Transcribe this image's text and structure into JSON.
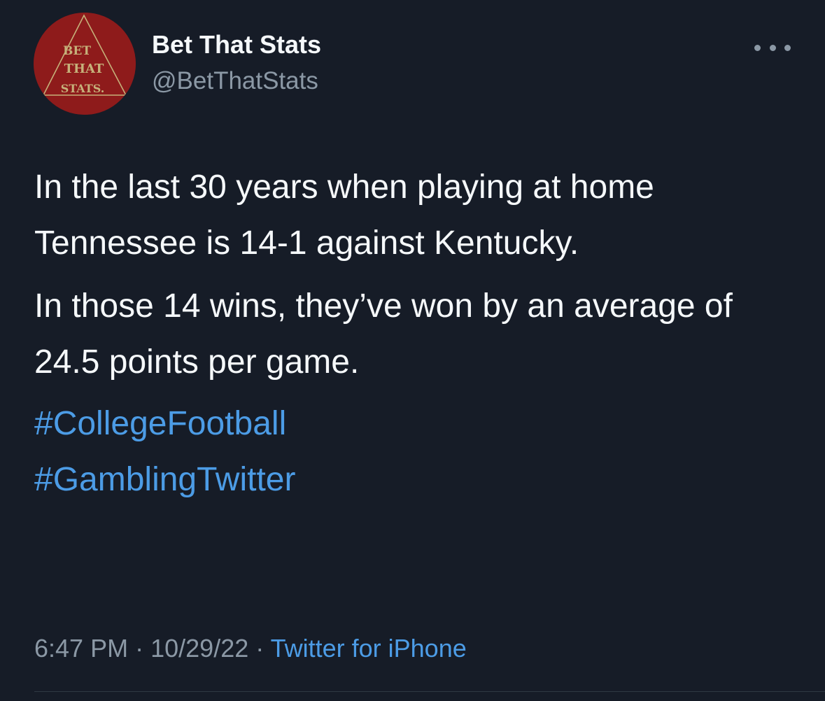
{
  "author": {
    "display_name": "Bet That Stats",
    "handle": "@BetThatStats",
    "avatar_logo_text": [
      "BET",
      "THAT",
      "STATS."
    ]
  },
  "tweet": {
    "paragraph_1": "In the last 30 years when playing at home Tennessee is 14-1 against Kentucky.",
    "paragraph_2": "In those 14 wins, they’ve won by an average of 24.5 points per game.",
    "hashtags": [
      "#CollegeFootball",
      "#GamblingTwitter"
    ]
  },
  "meta": {
    "time": "6:47 PM",
    "separator": "·",
    "date": "10/29/22",
    "source": "Twitter for iPhone"
  },
  "icons": {
    "more": "more-horizontal-icon"
  },
  "colors": {
    "background": "#161c27",
    "text": "#f5f8fa",
    "secondary_text": "#8b98a5",
    "link": "#4c9ce6",
    "avatar_bg": "#8e1b1b"
  }
}
